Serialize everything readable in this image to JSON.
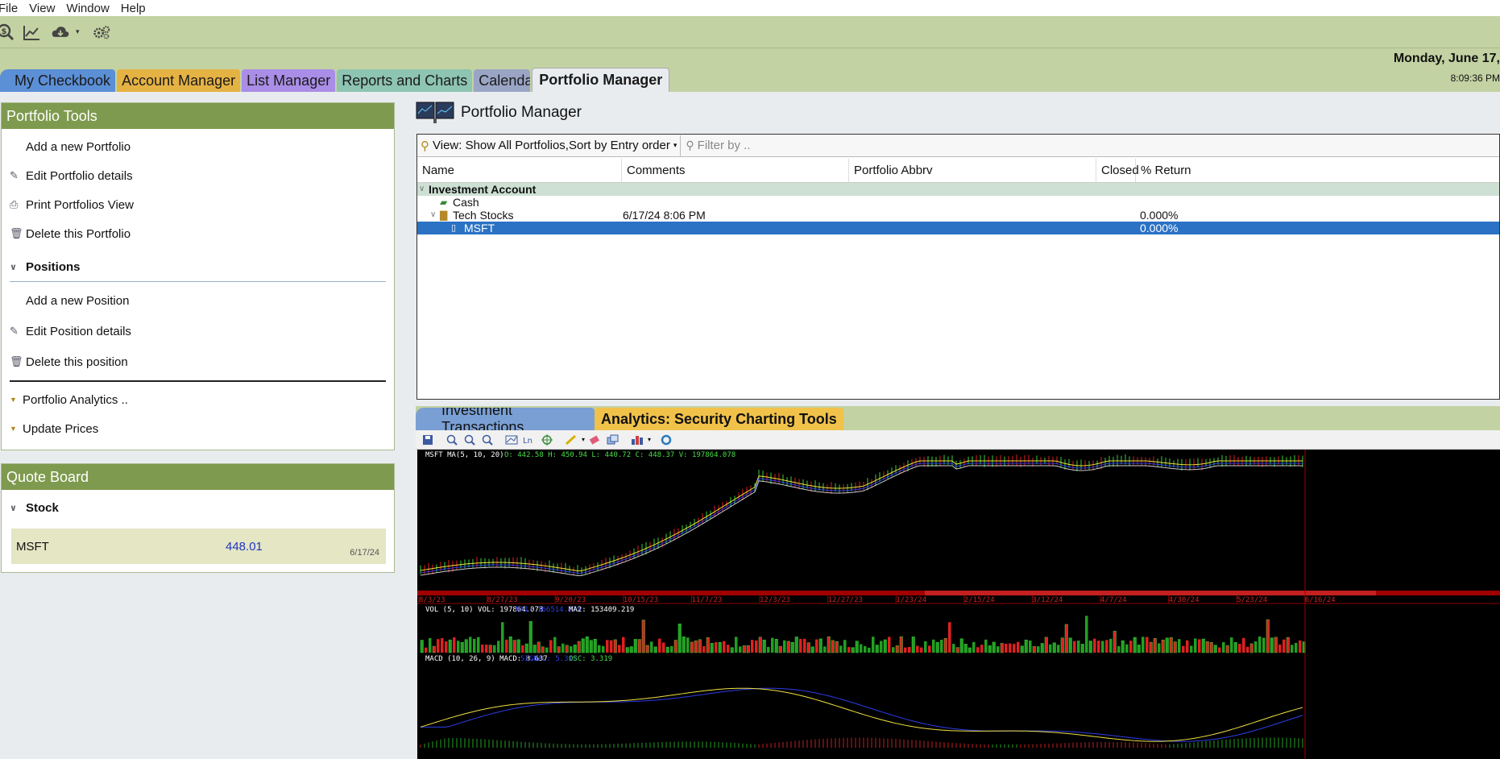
{
  "menu": [
    "File",
    "View",
    "Window",
    "Help"
  ],
  "toolbar_icons": [
    "dollar-search-icon",
    "chart-line-icon",
    "cloud-download-icon",
    "settings-gears-icon"
  ],
  "header": {
    "date": "Monday, June 17,",
    "time": "8:09:36 PM"
  },
  "tabs": [
    {
      "label": "My Checkbook",
      "color": "#5b8fd6"
    },
    {
      "label": "Account Manager",
      "color": "#e5b244"
    },
    {
      "label": "List Manager",
      "color": "#a98de6"
    },
    {
      "label": "Reports and Charts",
      "color": "#8dc4b2"
    },
    {
      "label": "Calendar",
      "color": "#9aa4c4"
    },
    {
      "label": "Portfolio Manager",
      "color": "#e9ecef"
    }
  ],
  "portfolio_tools": {
    "title": "Portfolio Tools",
    "items": [
      "Add a new Portfolio",
      "Edit Portfolio details",
      "Print Portfolios View",
      "Delete this Portfolio"
    ],
    "positions_title": "Positions",
    "position_items": [
      "Add a new Position",
      "Edit Position details",
      "Delete this position"
    ],
    "extra_items": [
      "Portfolio Analytics ..",
      "Update Prices"
    ]
  },
  "quote_board": {
    "title": "Quote Board",
    "section": "Stock",
    "symbol": "MSFT",
    "price": "448.01",
    "date": "6/17/24"
  },
  "main": {
    "title": "Portfolio Manager",
    "view_label": "View: Show All Portfolios,Sort by Entry order",
    "filter_placeholder": "Filter by ..",
    "columns": [
      "Name",
      "Comments",
      "Portfolio Abbrv",
      "Closed",
      "% Return"
    ],
    "group": "Investment Account",
    "rows": [
      {
        "name": "Cash",
        "comments": "",
        "return": ""
      },
      {
        "name": "Tech Stocks",
        "comments": "6/17/24 8:06 PM",
        "return": "0.000%"
      },
      {
        "name": "MSFT",
        "comments": "",
        "return": "0.000%"
      }
    ]
  },
  "bottom_tabs": [
    "Investment Transactions",
    "Analytics: Security Charting Tools"
  ],
  "chart": {
    "price_label": "MSFT MA(5, 10, 20)",
    "ohlcv": "O: 442.58  H: 450.94  L: 440.72  C: 448.37  V: 197864.078",
    "x_dates": [
      "8/3/23",
      "8/27/23",
      "9/20/23",
      "10/15/23",
      "11/7/23",
      "12/3/23",
      "12/27/23",
      "1/23/24",
      "2/15/24",
      "3/12/24",
      "4/7/24",
      "4/30/24",
      "5/23/24",
      "6/16/24"
    ],
    "vol_label": "VOL (5, 10)  VOL: 197864.078",
    "vol_ma1": "MA1: 166514.878",
    "vol_ma2": "MA2: 153409.219",
    "macd_label": "MACD (10, 26, 9)  MACD: 8.637",
    "macd_signal": "SIGNAL: 5.318",
    "macd_osc": "OSC: 3.319"
  }
}
